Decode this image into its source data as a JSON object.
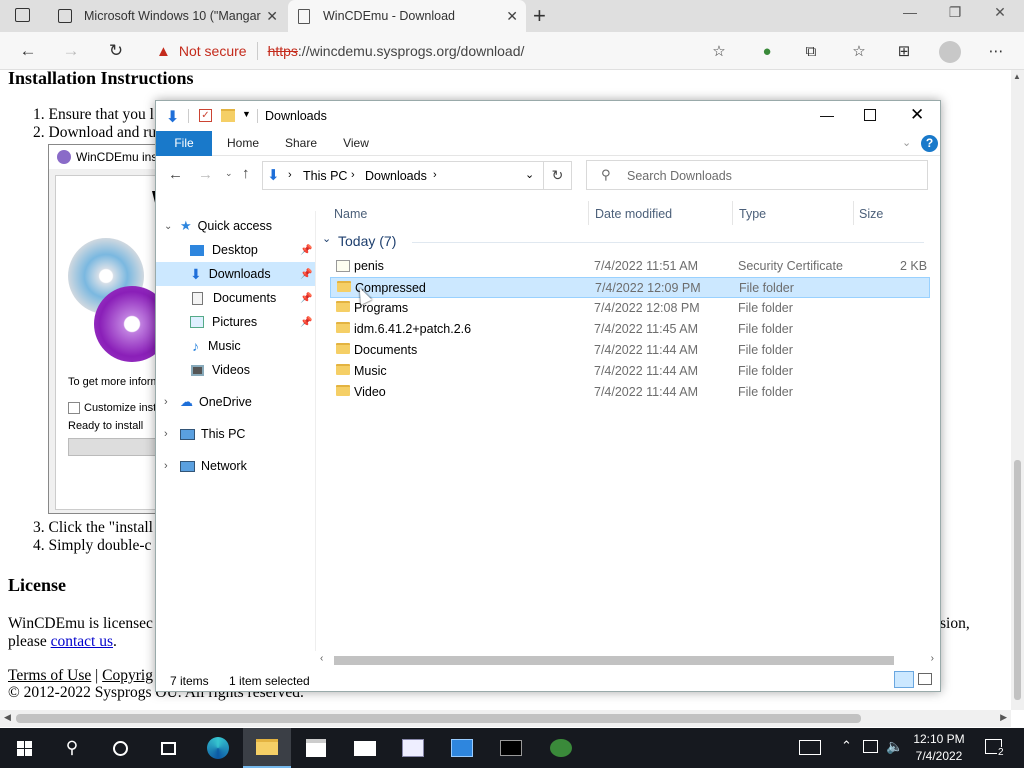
{
  "browser": {
    "tabs": [
      {
        "title": "Microsoft Windows 10 (\"Mangar"
      },
      {
        "title": "WinCDEmu - Download"
      }
    ],
    "security_label": "Not secure",
    "url_scheme": "https",
    "url_rest": "://wincdemu.sysprogs.org/download/"
  },
  "page": {
    "heading_install": "Installation Instructions",
    "step1": "1. Ensure that you l",
    "step2": "2. Download and ru",
    "installer_title": "WinCDEmu ins",
    "installer_big": "W",
    "installer_info": "To get more inform",
    "installer_checkbox": "Customize insta",
    "installer_status": "Ready to install",
    "step3": "3. Click the \"install",
    "step4": "4. Simply double-c",
    "heading_license": "License",
    "license_text": "WinCDEmu is licensec",
    "license_tail": "sion,",
    "please": "please ",
    "contact": "contact us",
    "period": ".",
    "terms": "Terms of Use",
    "sep": " | ",
    "copyright_link": "Copyrig",
    "copyright": "© 2012-2022 Sysprogs OU. All rights reserved."
  },
  "explorer": {
    "title": "Downloads",
    "ribbon_tabs": [
      "File",
      "Home",
      "Share",
      "View"
    ],
    "breadcrumb": [
      "This PC",
      "Downloads"
    ],
    "search_placeholder": "Search Downloads",
    "sidebar": {
      "quick_access": "Quick access",
      "items": [
        "Desktop",
        "Downloads",
        "Documents",
        "Pictures",
        "Music",
        "Videos"
      ],
      "onedrive": "OneDrive",
      "thispc": "This PC",
      "network": "Network"
    },
    "columns": [
      "Name",
      "Date modified",
      "Type",
      "Size"
    ],
    "group": "Today (7)",
    "files": [
      {
        "name": "penis",
        "date": "7/4/2022 11:51 AM",
        "type": "Security Certificate",
        "size": "2 KB"
      },
      {
        "name": "Compressed",
        "date": "7/4/2022 12:09 PM",
        "type": "File folder",
        "size": ""
      },
      {
        "name": "Programs",
        "date": "7/4/2022 12:08 PM",
        "type": "File folder",
        "size": ""
      },
      {
        "name": "idm.6.41.2+patch.2.6",
        "date": "7/4/2022 11:45 AM",
        "type": "File folder",
        "size": ""
      },
      {
        "name": "Documents",
        "date": "7/4/2022 11:44 AM",
        "type": "File folder",
        "size": ""
      },
      {
        "name": "Music",
        "date": "7/4/2022 11:44 AM",
        "type": "File folder",
        "size": ""
      },
      {
        "name": "Video",
        "date": "7/4/2022 11:44 AM",
        "type": "File folder",
        "size": ""
      }
    ],
    "status_count": "7 items",
    "status_selected": "1 item selected"
  },
  "taskbar": {
    "time": "12:10 PM",
    "date": "7/4/2022",
    "notif_count": "2"
  }
}
